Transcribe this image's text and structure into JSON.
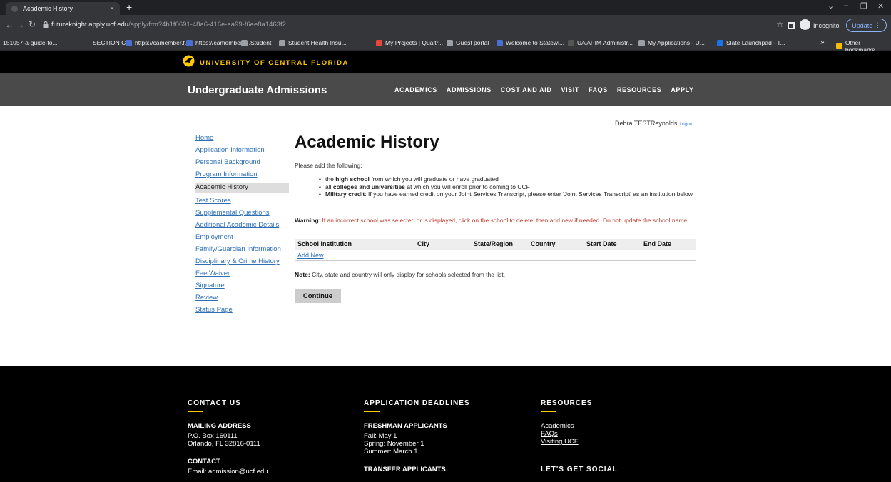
{
  "browser": {
    "tab_title": "Academic History",
    "tab_close": "×",
    "new_tab": "+",
    "url_domain": "futureknight.apply.ucf.edu",
    "url_path": "/apply/frm?4b1f0691-48a6-416e-aa99-f6ee8a1463f2",
    "incognito_label": "Incognito",
    "update_label": "Update",
    "bookmarks": [
      {
        "label": "151057-a-guide-to...",
        "color": "#35363a"
      },
      {
        "label": "SECTION C",
        "color": "#35363a"
      },
      {
        "label": "https://camember.f...",
        "color": "#4a6fd4"
      },
      {
        "label": "https://camember.f...",
        "color": "#4a6fd4"
      },
      {
        "label": "Student",
        "color": "#9aa0a6"
      },
      {
        "label": "Student Health Insu...",
        "color": "#9aa0a6"
      },
      {
        "label": "My Projects | Qualtr...",
        "color": "#e8453c"
      },
      {
        "label": "Guest portal",
        "color": "#9aa0a6"
      },
      {
        "label": "Welcome to Statewi...",
        "color": "#4a6fd4"
      },
      {
        "label": "UA APIM Administr...",
        "color": "#555"
      },
      {
        "label": "My Applications - U...",
        "color": "#9aa0a6"
      },
      {
        "label": "Slate Launchpad - T...",
        "color": "#1a73e8"
      }
    ],
    "more_bookmarks": "»",
    "other_bookmarks": "Other bookmarks"
  },
  "site": {
    "university": "UNIVERSITY OF CENTRAL FLORIDA",
    "title": "Undergraduate Admissions",
    "nav": [
      "ACADEMICS",
      "ADMISSIONS",
      "COST AND AID",
      "VISIT",
      "FAQS",
      "RESOURCES",
      "APPLY"
    ],
    "accent": "#ffc904"
  },
  "user": {
    "name": "Debra TESTReynolds",
    "logout": "Logout"
  },
  "sidenav": [
    {
      "label": "Home",
      "active": false
    },
    {
      "label": "Application Information",
      "active": false
    },
    {
      "label": "Personal Background",
      "active": false
    },
    {
      "label": "Program Information",
      "active": false
    },
    {
      "label": "Academic History",
      "active": true
    },
    {
      "label": "Test Scores",
      "active": false
    },
    {
      "label": "Supplemental Questions",
      "active": false
    },
    {
      "label": "Additional Academic Details",
      "active": false
    },
    {
      "label": "Employment",
      "active": false
    },
    {
      "label": "Family/Guardian Information",
      "active": false
    },
    {
      "label": "Disciplinary & Crime History",
      "active": false
    },
    {
      "label": "Fee Waiver",
      "active": false
    },
    {
      "label": "Signature",
      "active": false
    },
    {
      "label": "Review",
      "active": false
    },
    {
      "label": "Status Page",
      "active": false
    }
  ],
  "main": {
    "title": "Academic History",
    "intro": "Please add the following:",
    "bullet1_pre": "the ",
    "bullet1_bold": "high school",
    "bullet1_post": " from which you will graduate or have graduated",
    "bullet2_pre": "all ",
    "bullet2_bold": "colleges and universities",
    "bullet2_post": " at which you will enroll prior to coming to UCF",
    "bullet3_bold": "Military credit",
    "bullet3_post": ": If you have earned credit on your Joint Services Transcript, please enter 'Joint Services Transcript' as an institution below.",
    "warning_label": "Warning",
    "warning_text": ": If an incorrect school was selected or is displayed, click on the school to delete; then add new if needed.  Do not update the school name.",
    "table_headers": [
      "School Institution",
      "City",
      "State/Region",
      "Country",
      "Start Date",
      "End Date"
    ],
    "add_new": "Add New",
    "note_label": "Note:",
    "note_text": " City, state and country will only display for schools selected from the list.",
    "continue": "Continue"
  },
  "footer": {
    "contact_heading": "CONTACT US",
    "mailing_heading": "MAILING ADDRESS",
    "mailing_line1": "P.O. Box 160111",
    "mailing_line2": "Orlando, FL 32816-0111",
    "contact_sub": "CONTACT",
    "email": "Email: admission@ucf.edu",
    "deadlines_heading": "APPLICATION DEADLINES",
    "freshman_heading": "FRESHMAN APPLICANTS",
    "fall": "Fall: May 1",
    "spring": "Spring: November 1",
    "summer": "Summer: March 1",
    "transfer_heading": "TRANSFER APPLICANTS",
    "resources_heading": "RESOURCES",
    "resource_links": [
      "Academics",
      "FAQs",
      "Visiting UCF"
    ],
    "social_heading": "LET'S GET SOCIAL"
  }
}
